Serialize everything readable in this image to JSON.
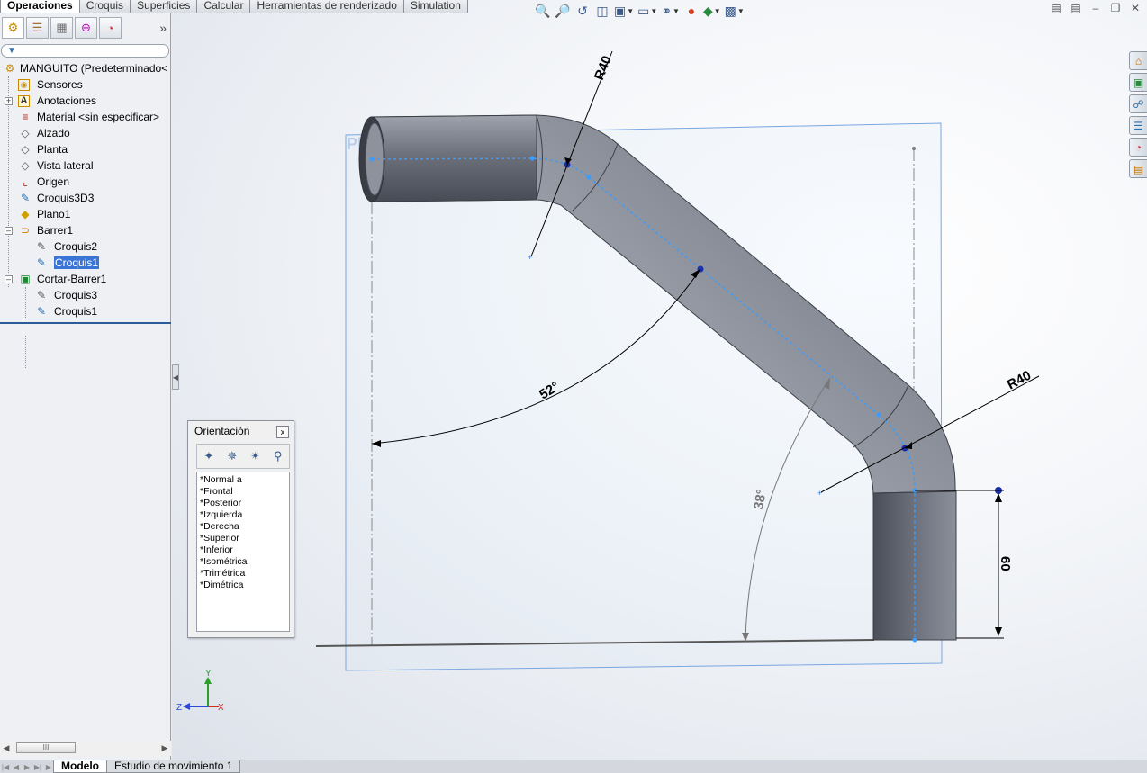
{
  "command_tabs": [
    {
      "label": "Operaciones",
      "active": true
    },
    {
      "label": "Croquis",
      "active": false
    },
    {
      "label": "Superficies",
      "active": false
    },
    {
      "label": "Calcular",
      "active": false
    },
    {
      "label": "Herramientas de renderizado",
      "active": false
    },
    {
      "label": "Simulation",
      "active": false
    }
  ],
  "tree": {
    "root": "MANGUITO  (Predeterminado<",
    "items": [
      {
        "label": "Sensores",
        "icon": "sensor-icon"
      },
      {
        "label": "Anotaciones",
        "icon": "annotation-icon"
      },
      {
        "label": "Material <sin especificar>",
        "icon": "material-icon"
      },
      {
        "label": "Alzado",
        "icon": "plane-icon"
      },
      {
        "label": "Planta",
        "icon": "plane-icon"
      },
      {
        "label": "Vista lateral",
        "icon": "plane-icon"
      },
      {
        "label": "Origen",
        "icon": "origin-icon"
      },
      {
        "label": "Croquis3D3",
        "icon": "sketch3d-icon"
      },
      {
        "label": "Plano1",
        "icon": "plane-feature-icon"
      },
      {
        "label": "Barrer1",
        "icon": "sweep-icon"
      },
      {
        "label": "Croquis2",
        "icon": "sketch-icon"
      },
      {
        "label": "Croquis1",
        "icon": "sketch-icon",
        "selected": true
      },
      {
        "label": "Cortar-Barrer1",
        "icon": "cut-sweep-icon"
      },
      {
        "label": "Croquis3",
        "icon": "sketch-icon"
      },
      {
        "label": "Croquis1",
        "icon": "sketch-icon"
      }
    ]
  },
  "scrollbar_thumb": "III",
  "viewport": {
    "plane_label": "Plano1",
    "dims": {
      "radius_top": "R40",
      "radius_bottom": "R40",
      "angle_main": "52°",
      "angle_secondary": "38°",
      "length": "60"
    },
    "triad": {
      "y": "Y",
      "z": "Z",
      "x": "X"
    }
  },
  "orientation_dialog": {
    "title": "Orientación",
    "close": "x",
    "views": [
      "*Normal a",
      "*Frontal",
      "*Posterior",
      "*Izquierda",
      "*Derecha",
      "*Superior",
      "*Inferior",
      "*Isométrica",
      "*Trimétrica",
      "*Dimétrica"
    ]
  },
  "bottom_tabs": [
    {
      "label": "Modelo",
      "active": true
    },
    {
      "label": "Estudio de movimiento 1",
      "active": false
    }
  ],
  "colors": {
    "selection": "#3875d7",
    "sketch_path": "#3a9cff",
    "plane_border": "#7aa6e0",
    "tube_dark": "#5a5f6a",
    "tube_light": "#8a8f9a"
  }
}
